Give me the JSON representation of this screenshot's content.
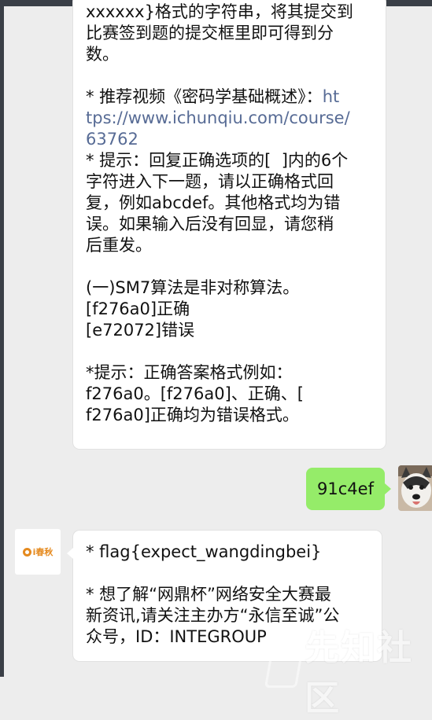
{
  "conversation": {
    "message_1": {
      "lines": [
        "xxxxxx}格式的字符串，将其提交到",
        "比赛签到题的提交框里即可得到分",
        "数。",
        "",
        "* 推荐视频《密码学基础概述》："
      ],
      "link_part_1": "ht",
      "link_part_2": "tps://www.ichunqiu.com/course/",
      "link_part_3": "63762",
      "lines_after": [
        "* 提示：回复正确选项的[  ]内的6个",
        "字符进入下一题，请以正确格式回",
        "复，例如abcdef。其他格式均为错",
        "误。如果输入后没有回显，请您稍",
        "后重发。",
        "",
        "(一)SM7算法是非对称算法。",
        "[f276a0]正确",
        "[e72072]错误",
        "",
        "*提示：正确答案格式例如：",
        "f276a0。[f276a0]、正确、[",
        "f276a0]正确均为错误格式。"
      ]
    },
    "user_reply": "91c4ef",
    "message_2": {
      "lines": [
        "* flag{expect_wangdingbei}",
        "",
        "* 想了解“网鼎杯”网络安全大赛最",
        "新资讯,请关注主办方“永信至诚”公",
        "众号，ID：INTEGROUP"
      ]
    },
    "brand_avatar_label": "i春秋",
    "watermark": "先知社区"
  },
  "colors": {
    "chat_background": "#ededed",
    "incoming_bubble": "#ffffff",
    "outgoing_bubble": "#95ec69",
    "link": "#576b95",
    "brand_orange": "#e58a1f"
  },
  "icons": {
    "user_avatar": "husky-dog-photo-avatar",
    "brand_avatar": "ichunqiu-logo-avatar"
  }
}
